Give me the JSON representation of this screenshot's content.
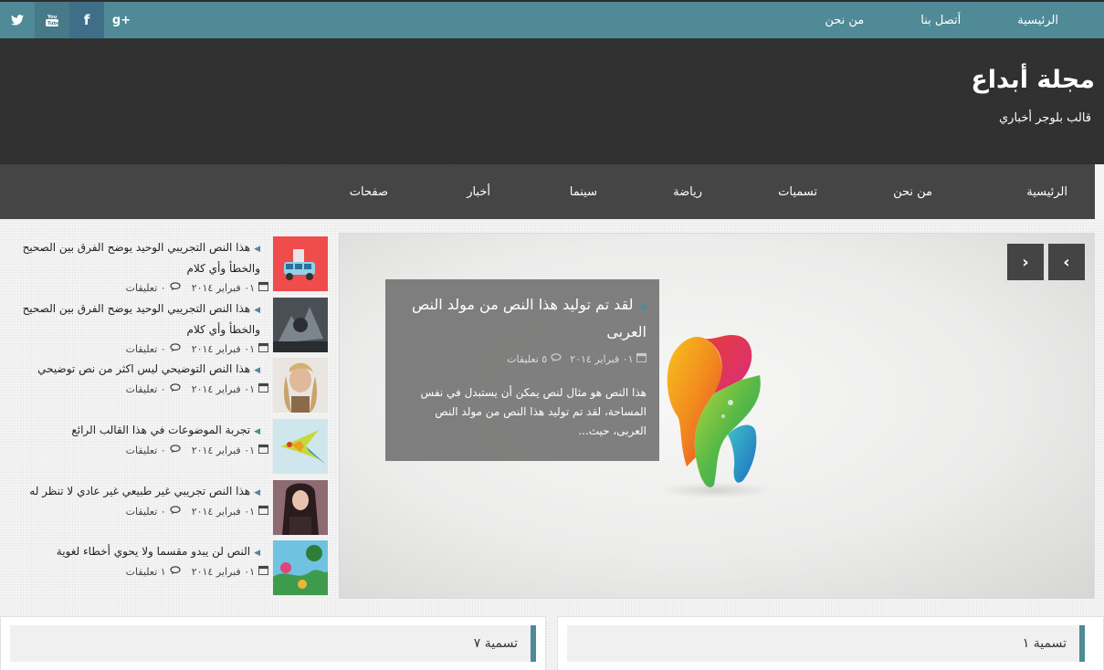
{
  "colors": {
    "accent": "#4f8a96",
    "header_bg": "#2e2e2e",
    "nav_bg": "#454545"
  },
  "topbar": {
    "nav": [
      "الرئيسية",
      "أتصل بنا",
      "من نحن"
    ],
    "social": [
      {
        "icon": "googleplus-icon",
        "glyph": "g+"
      },
      {
        "icon": "facebook-icon",
        "glyph": "f"
      },
      {
        "icon": "youtube-icon",
        "glyph": "You"
      },
      {
        "icon": "twitter-icon",
        "glyph": "t"
      }
    ]
  },
  "header": {
    "title": "مجلة أبداع",
    "description": "قالب بلوجر أخباري"
  },
  "mainnav": [
    "الرئيسية",
    "من نحن",
    "تسميات",
    "رياضة",
    "سينما",
    "أخبار",
    "صفحات"
  ],
  "slider": {
    "prev_glyph": "›",
    "next_glyph": "‹",
    "caption": {
      "title": "لقد تم توليد هذا النص من مولد النص العربى",
      "date": "٠١ فبراير ٢٠١٤",
      "comments": "٥ تعليقات",
      "text": "هذا النص هو مثال لنص يمكن أن يستبدل في نفس المساحة، لقد تم توليد هذا النص من مولد النص العربى، حيث..."
    }
  },
  "recent_posts": [
    {
      "title": "هذا النص التجريبي الوحيد يوضح الفرق بين الصحيح والخطأ وأي كلام",
      "date": "٠١ فبراير ٢٠١٤",
      "comments": "٠ تعليقات"
    },
    {
      "title": "هذا النص التجريبي الوحيد يوضح الفرق بين الصحيح والخطأ وأي كلام",
      "date": "٠١ فبراير ٢٠١٤",
      "comments": "٠ تعليقات"
    },
    {
      "title": "هذا النص التوضيحي ليس اكثر من نص توضيحي",
      "date": "٠١ فبراير ٢٠١٤",
      "comments": "٠ تعليقات"
    },
    {
      "title": "تجربة الموضوعات في هذا القالب الرائع",
      "date": "٠١ فبراير ٢٠١٤",
      "comments": "٠ تعليقات"
    },
    {
      "title": "هذا النص تجريبي غير طبيعي غير عادي لا تنظر له",
      "date": "٠١ فبراير ٢٠١٤",
      "comments": "٠ تعليقات"
    },
    {
      "title": "النص لن يبدو مقسما ولا يحوي أخطاء لغوية",
      "date": "٠١ فبراير ٢٠١٤",
      "comments": "١ تعليقات"
    }
  ],
  "widgets": {
    "right_label": "تسمية ١",
    "left_label": "تسمية ٧"
  }
}
